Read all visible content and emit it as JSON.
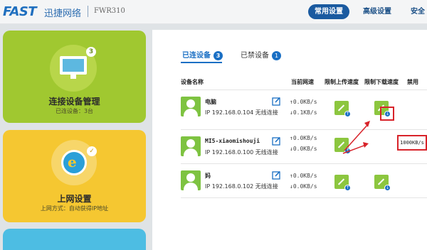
{
  "header": {
    "logo": "FAST",
    "brand": "迅捷网络",
    "model": "FWR310",
    "nav": [
      "常用设置",
      "高级设置",
      "安全"
    ]
  },
  "cards": [
    {
      "title": "连接设备管理",
      "subtitle": "已连设备：3台",
      "badge": "3",
      "icon": "monitor-icon"
    },
    {
      "title": "上网设置",
      "subtitle": "上网方式：自动获得IP地址",
      "badge": "✓",
      "icon": "internet-explorer-icon"
    }
  ],
  "tabs": [
    {
      "label": "已连设备",
      "count": "3"
    },
    {
      "label": "已禁设备",
      "count": "1"
    }
  ],
  "table": {
    "headers": [
      "设备名称",
      "当前网速",
      "限制上传速度",
      "限制下载速度",
      "禁用"
    ],
    "rows": [
      {
        "name": "电脑",
        "ip": "IP 192.168.0.104 无线连接",
        "up": "↑0.0KB/s",
        "down": "↓0.1KB/s",
        "action": "本机"
      },
      {
        "name": "MI5-xiaomishouji",
        "ip": "IP 192.168.0.100 无线连接",
        "up": "↑0.0KB/s",
        "down": "↓0.0KB/s",
        "download_limit": "1000KB/s"
      },
      {
        "name": "妈",
        "ip": "IP 192.168.0.102 无线连接",
        "up": "↑0.0KB/s",
        "down": "↓0.0KB/s"
      }
    ]
  },
  "colors": {
    "accent": "#1a6fc4",
    "green": "#8cc63f",
    "card_green": "#a0c830",
    "card_yellow": "#f5c731",
    "highlight": "#d8232a"
  }
}
